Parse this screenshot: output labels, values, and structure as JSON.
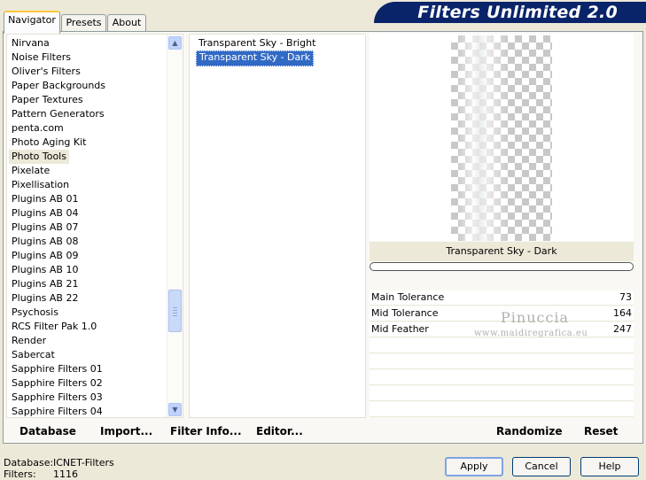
{
  "tabs": [
    "Navigator",
    "Presets",
    "About"
  ],
  "banner_title": "Filters Unlimited 2.0",
  "categories": [
    "Nirvana",
    "Noise Filters",
    "Oliver's Filters",
    "Paper Backgrounds",
    "Paper Textures",
    "Pattern Generators",
    "penta.com",
    "Photo Aging Kit",
    "Photo Tools",
    "Pixelate",
    "Pixellisation",
    "Plugins AB 01",
    "Plugins AB 04",
    "Plugins AB 07",
    "Plugins AB 08",
    "Plugins AB 09",
    "Plugins AB 10",
    "Plugins AB 21",
    "Plugins AB 22",
    "Psychosis",
    "RCS Filter Pak 1.0",
    "Render",
    "Sabercat",
    "Sapphire Filters 01",
    "Sapphire Filters 02",
    "Sapphire Filters 03",
    "Sapphire Filters 04"
  ],
  "selected_category": "Photo Tools",
  "filters": [
    "Transparent Sky - Bright",
    "Transparent Sky - Dark"
  ],
  "selected_filter": "Transparent Sky - Dark",
  "preview_label": "Transparent Sky - Dark",
  "parameters": [
    {
      "name": "Main Tolerance",
      "value": "73"
    },
    {
      "name": "Mid Tolerance",
      "value": "164"
    },
    {
      "name": "Mid Feather",
      "value": "247"
    }
  ],
  "watermark": {
    "line1": "Pinuccia",
    "line2": "www.maidiregrafica.eu"
  },
  "buttons": {
    "database": "Database",
    "import": "Import...",
    "filter_info": "Filter Info...",
    "editor": "Editor...",
    "randomize": "Randomize",
    "reset": "Reset",
    "apply": "Apply",
    "cancel": "Cancel",
    "help": "Help"
  },
  "info": {
    "database_label": "Database:",
    "database_value": "ICNET-Filters",
    "filters_label": "Filters:",
    "filters_value": "1116"
  }
}
